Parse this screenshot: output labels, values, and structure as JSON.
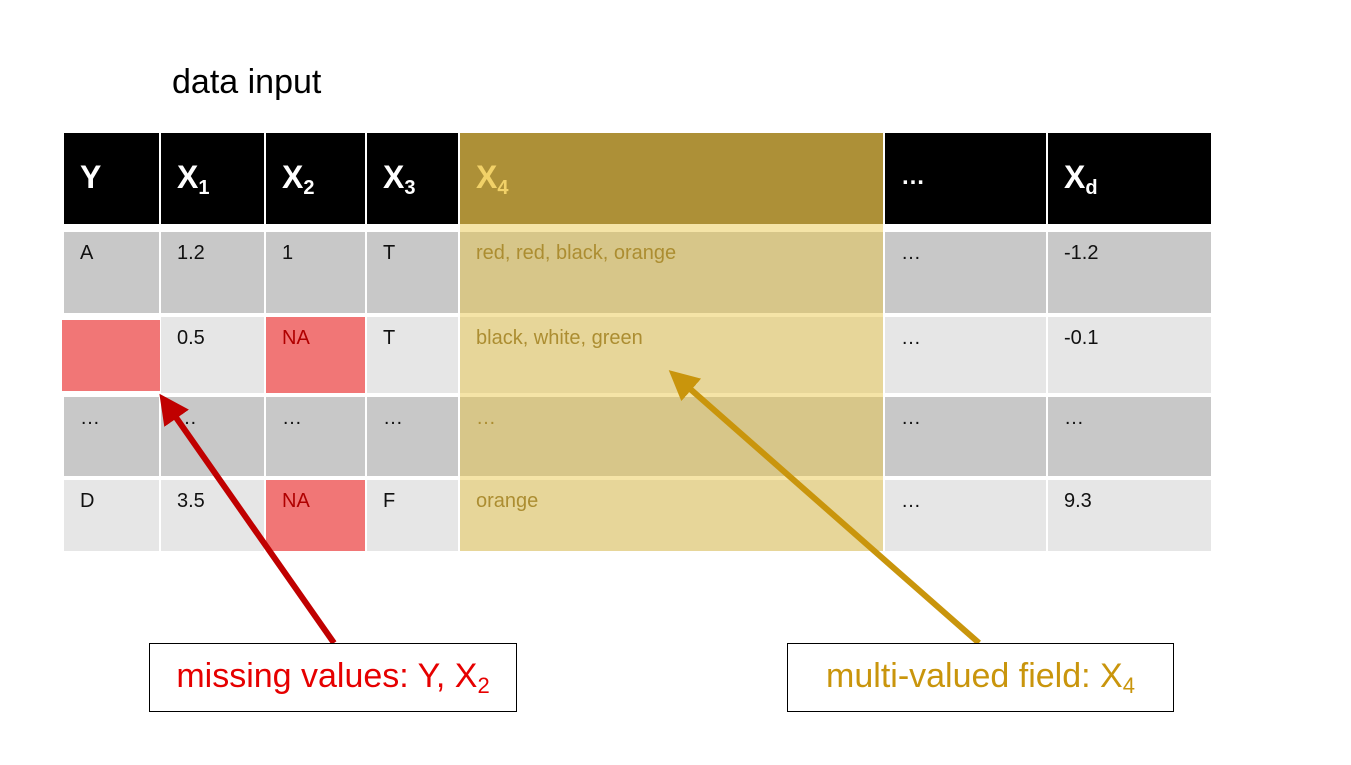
{
  "title": "data input",
  "headers": {
    "y": "Y",
    "x1": {
      "base": "X",
      "sub": "1"
    },
    "x2": {
      "base": "X",
      "sub": "2"
    },
    "x3": {
      "base": "X",
      "sub": "3"
    },
    "x4": {
      "base": "X",
      "sub": "4"
    },
    "ellipsis": "…",
    "xd": {
      "base": "X",
      "sub": "d"
    }
  },
  "rows": [
    {
      "y": "A",
      "x1": "1.2",
      "x2": "1",
      "x3": "T",
      "x4": "red, red, black, orange",
      "dots": "…",
      "xd": "-1.2"
    },
    {
      "y": "",
      "x1": "0.5",
      "x2": "NA",
      "x3": "T",
      "x4": "black, white, green",
      "dots": "…",
      "xd": "-0.1"
    },
    {
      "y": "…",
      "x1": "…",
      "x2": "…",
      "x3": "…",
      "x4": "…",
      "dots": "…",
      "xd": "…"
    },
    {
      "y": "D",
      "x1": "3.5",
      "x2": "NA",
      "x3": "F",
      "x4": "orange",
      "dots": "…",
      "xd": "9.3"
    }
  ],
  "callouts": {
    "missing": {
      "text": "missing values: Y, X",
      "sub": "2"
    },
    "multi": {
      "text": "multi-valued field: X",
      "sub": "4"
    }
  },
  "colors": {
    "missing_fill": "#f17676",
    "missing_arrow": "#c00000",
    "multi_highlight": "#e8c43c",
    "multi_arrow": "#c9950c"
  }
}
